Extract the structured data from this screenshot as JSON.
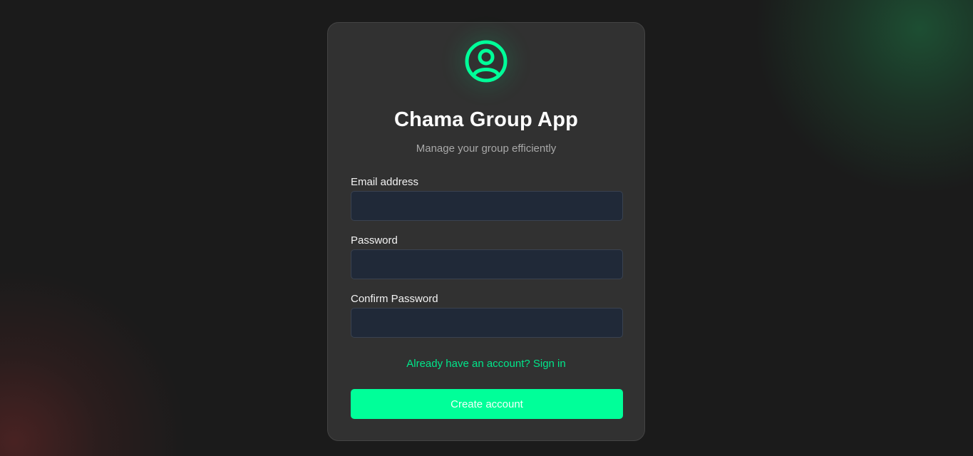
{
  "app": {
    "title": "Chama Group App",
    "subtitle": "Manage your group efficiently",
    "logo_icon": "user-circle-icon"
  },
  "form": {
    "email_label": "Email address",
    "email_value": "",
    "password_label": "Password",
    "password_value": "",
    "confirm_label": "Confirm Password",
    "confirm_value": "",
    "signin_link": "Already have an account? Sign in",
    "submit_label": "Create account"
  },
  "colors": {
    "accent": "#00ff99",
    "link": "#00e68a",
    "background": "#1b1b1b",
    "card": "#313131",
    "input": "#202938"
  }
}
